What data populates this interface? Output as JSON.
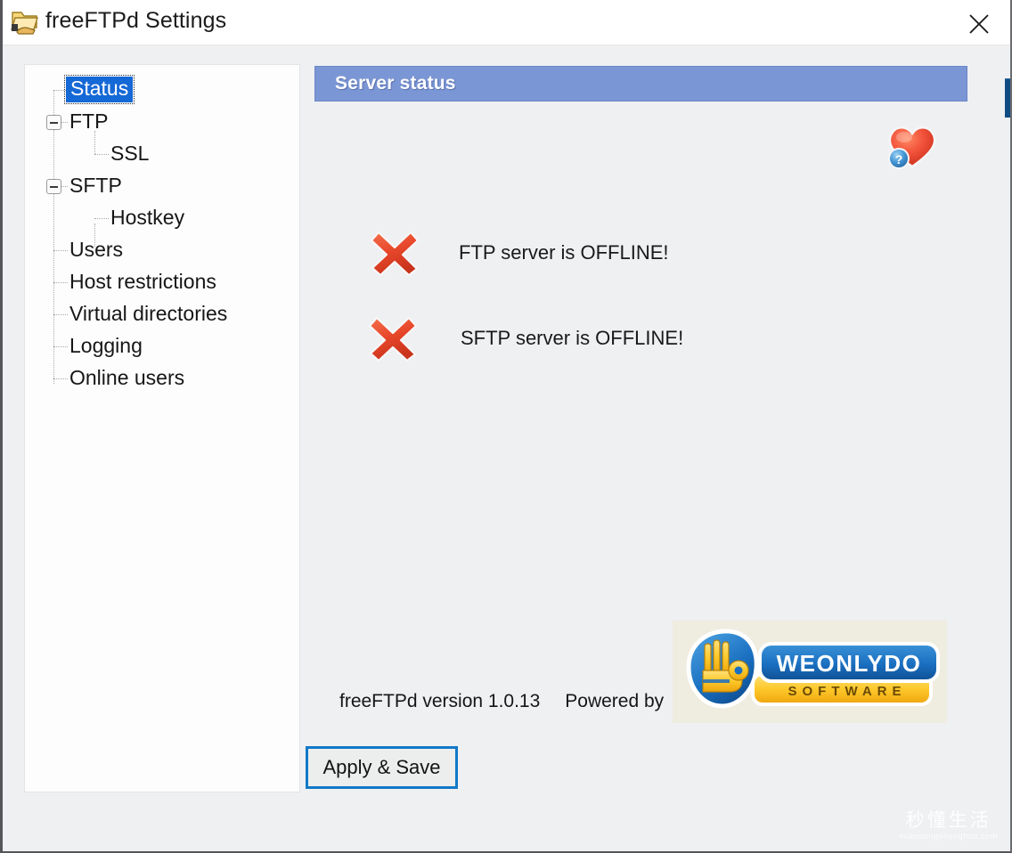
{
  "window": {
    "title": "freeFTPd Settings",
    "app_icon": "shared-folder-icon",
    "close_label": "×"
  },
  "sidebar": {
    "items": [
      {
        "label": "Status",
        "icon": "tree-leaf-icon",
        "selected": true,
        "level": 1,
        "expander": "none"
      },
      {
        "label": "FTP",
        "icon": "tree-branch-icon",
        "selected": false,
        "level": 1,
        "expander": "minus"
      },
      {
        "label": "SSL",
        "icon": "tree-leaf-icon",
        "selected": false,
        "level": 2,
        "expander": "none"
      },
      {
        "label": "SFTP",
        "icon": "tree-branch-icon",
        "selected": false,
        "level": 1,
        "expander": "minus"
      },
      {
        "label": "Hostkey",
        "icon": "tree-leaf-icon",
        "selected": false,
        "level": 2,
        "expander": "none"
      },
      {
        "label": "Users",
        "icon": "tree-leaf-icon",
        "selected": false,
        "level": 1,
        "expander": "none"
      },
      {
        "label": "Host restrictions",
        "icon": "tree-leaf-icon",
        "selected": false,
        "level": 1,
        "expander": "none"
      },
      {
        "label": "Virtual directories",
        "icon": "tree-leaf-icon",
        "selected": false,
        "level": 1,
        "expander": "none"
      },
      {
        "label": "Logging",
        "icon": "tree-leaf-icon",
        "selected": false,
        "level": 1,
        "expander": "none"
      },
      {
        "label": "Online users",
        "icon": "tree-leaf-icon",
        "selected": false,
        "level": 1,
        "expander": "none"
      }
    ]
  },
  "main": {
    "header": "Server status",
    "help_icon": "heart-help-icon",
    "statuses": [
      {
        "icon": "red-x-icon",
        "text": "FTP server is OFFLINE!"
      },
      {
        "icon": "red-x-icon",
        "text": "SFTP server is OFFLINE!"
      }
    ],
    "version_text": "freeFTPd version 1.0.13",
    "powered_by_text": "Powered by",
    "logo": {
      "icon": "weonlydo-logo-icon",
      "brand": "WEONLYDO",
      "tagline": "SOFTWARE"
    }
  },
  "footer": {
    "apply_save_label": "Apply & Save"
  },
  "watermark": {
    "main": "秒懂生活",
    "sub": "miaodongshenghuo.com"
  },
  "colors": {
    "title_bar": "#ffffff",
    "body_background": "#eff0f2",
    "tree_background": "#fdfdfd",
    "header_blue": "#7b96d4",
    "selection_blue": "#1569d6",
    "focus_blue": "#1179c8",
    "status_red": "#e8482b",
    "logo_blue": "#1a6fc0",
    "logo_yellow": "#fdc82a",
    "logo_background": "#efece0"
  }
}
